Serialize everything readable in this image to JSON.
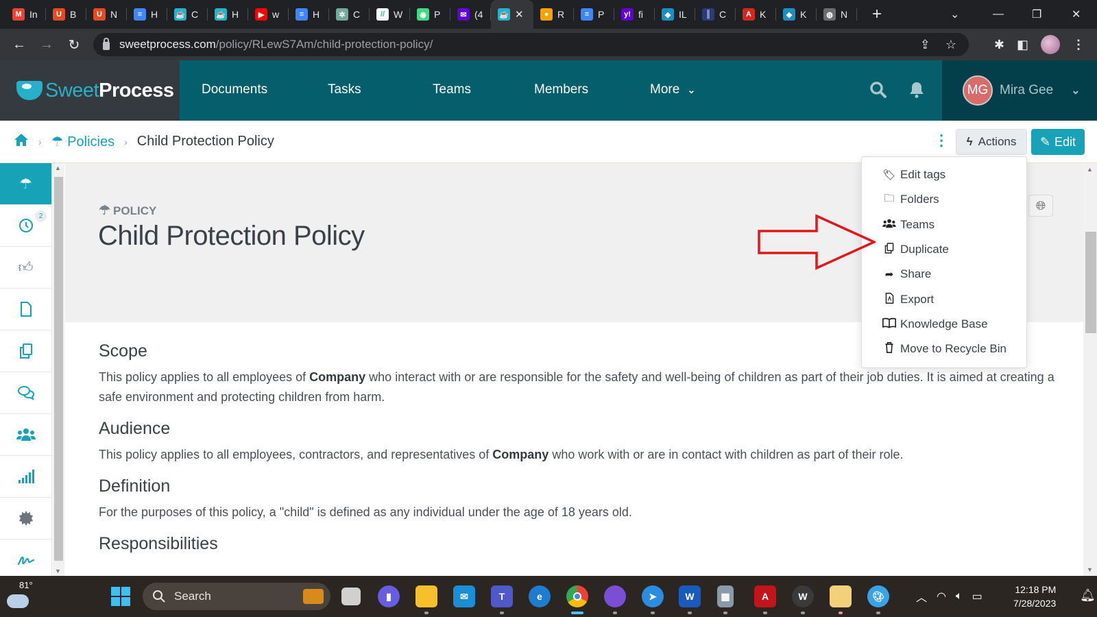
{
  "browser": {
    "tabs": [
      {
        "label": "In",
        "icon": "gmail-icon",
        "color": "#ea4335",
        "glyph": "M"
      },
      {
        "label": "B",
        "icon": "udemy-icon",
        "color": "#e54b21",
        "glyph": "U"
      },
      {
        "label": "N",
        "icon": "udemy-icon",
        "color": "#e54b21",
        "glyph": "U"
      },
      {
        "label": "H",
        "icon": "google-docs-icon",
        "color": "#4285f4",
        "glyph": "≡"
      },
      {
        "label": "C",
        "icon": "sweetprocess-icon",
        "color": "#27b1c9",
        "glyph": "☕"
      },
      {
        "label": "H",
        "icon": "sweetprocess-icon",
        "color": "#27b1c9",
        "glyph": "☕"
      },
      {
        "label": "w",
        "icon": "youtube-icon",
        "color": "#ff0000",
        "glyph": "▶"
      },
      {
        "label": "H",
        "icon": "google-docs-icon",
        "color": "#4285f4",
        "glyph": "≡"
      },
      {
        "label": "C",
        "icon": "chatgpt-icon",
        "color": "#74aa9c",
        "glyph": "✲"
      },
      {
        "label": "W",
        "icon": "wrike-icon",
        "color": "#ffffff",
        "glyph": "//"
      },
      {
        "label": "P",
        "icon": "android-icon",
        "color": "#3ddc84",
        "glyph": "◉"
      },
      {
        "label": "(4",
        "icon": "yahoo-mail-icon",
        "color": "#6001d2",
        "glyph": "✉"
      },
      {
        "label": "",
        "icon": "sweetprocess-icon",
        "color": "#27b1c9",
        "glyph": "☕",
        "active": true
      },
      {
        "label": "R",
        "icon": "reminder-icon",
        "color": "#f4a300",
        "glyph": "●"
      },
      {
        "label": "P",
        "icon": "google-docs-icon",
        "color": "#4285f4",
        "glyph": "≡"
      },
      {
        "label": "fi",
        "icon": "yahoo-icon",
        "color": "#6001d2",
        "glyph": "y!"
      },
      {
        "label": "IL",
        "icon": "diamond-icon",
        "color": "#1b8fc4",
        "glyph": "◆"
      },
      {
        "label": "C",
        "icon": "audio-icon",
        "color": "#2a3b7a",
        "glyph": "║"
      },
      {
        "label": "K",
        "icon": "acrobat-icon",
        "color": "#d7261e",
        "glyph": "A"
      },
      {
        "label": "K",
        "icon": "diamond-icon",
        "color": "#1b8fc4",
        "glyph": "◆"
      },
      {
        "label": "N",
        "icon": "globe-icon",
        "color": "#6d6d6d",
        "glyph": "◍"
      }
    ],
    "new_tab": "+",
    "close_tab": "✕",
    "url_host": "sweetprocess.com",
    "url_path": "/policy/RLewS7Am/child-protection-policy/"
  },
  "app": {
    "logo_sweet": "Sweet",
    "logo_process": "Process",
    "nav": [
      {
        "label": "Documents"
      },
      {
        "label": "Tasks"
      },
      {
        "label": "Teams"
      },
      {
        "label": "Members"
      },
      {
        "label": "More"
      }
    ],
    "user_initials": "MG",
    "user_name": "Mira Gee"
  },
  "breadcrumb": {
    "section": "Policies",
    "current": "Child Protection Policy"
  },
  "buttons": {
    "actions": "Actions",
    "edit": "Edit"
  },
  "sidebar": {
    "items": [
      {
        "name": "policies",
        "icon": "umbrella-icon",
        "active": true
      },
      {
        "name": "history",
        "icon": "clock-icon",
        "badge": "2"
      },
      {
        "name": "approvals",
        "icon": "thumbs-up-icon"
      },
      {
        "name": "document",
        "icon": "file-icon"
      },
      {
        "name": "copies",
        "icon": "copy-icon"
      },
      {
        "name": "comments",
        "icon": "comments-icon"
      },
      {
        "name": "teams",
        "icon": "users-icon"
      },
      {
        "name": "stats",
        "icon": "signal-icon"
      },
      {
        "name": "settings",
        "icon": "gear-icon"
      },
      {
        "name": "signature",
        "icon": "signature-icon"
      }
    ]
  },
  "document": {
    "type_label": "POLICY",
    "title": "Child Protection Policy",
    "sections": [
      {
        "heading": "Scope",
        "before": "This policy applies to all employees of ",
        "bold": "Company",
        "after": " who interact with or are responsible for the safety and well-being of children as part of their job duties. It is aimed at creating a safe environment and protecting children from harm."
      },
      {
        "heading": "Audience",
        "before": "This policy applies to all employees, contractors, and representatives of ",
        "bold": "Company",
        "after": " who work with or are in contact with children as part of their role."
      },
      {
        "heading": "Definition",
        "before": "For the purposes of this policy, a \"child\" is defined as any individual under the age of 18 years old.",
        "bold": "",
        "after": ""
      },
      {
        "heading": "Responsibilities",
        "before": "",
        "bold": "",
        "after": ""
      }
    ]
  },
  "actions_menu": {
    "items": [
      {
        "label": "Edit tags",
        "icon": "tag-icon"
      },
      {
        "label": "Folders",
        "icon": "folder-icon"
      },
      {
        "label": "Teams",
        "icon": "users-icon"
      },
      {
        "label": "Duplicate",
        "icon": "copy-icon"
      },
      {
        "label": "Share",
        "icon": "share-icon"
      },
      {
        "label": "Export",
        "icon": "pdf-file-icon"
      },
      {
        "label": "Knowledge Base",
        "icon": "book-icon"
      },
      {
        "label": "Move to Recycle Bin",
        "icon": "trash-icon"
      }
    ]
  },
  "annotation": {
    "color": "#e3171b",
    "points_to": "Duplicate"
  },
  "taskbar": {
    "weather_temp": "81°",
    "search_placeholder": "Search",
    "time": "12:18 PM",
    "date": "7/28/2023"
  }
}
